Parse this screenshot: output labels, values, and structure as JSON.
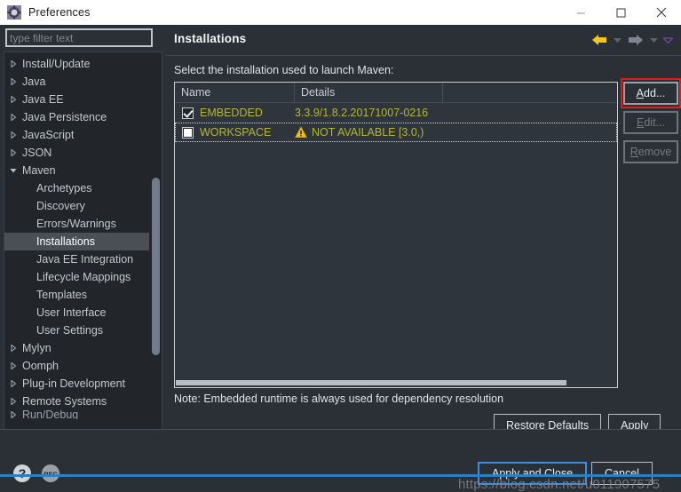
{
  "window": {
    "title": "Preferences",
    "icon": "preferences-gear-icon",
    "minimize_label": "minimize-icon",
    "maximize_label": "maximize-icon",
    "close_label": "close-icon"
  },
  "filter": {
    "placeholder": "type filter text",
    "value": ""
  },
  "sidebar": {
    "items": [
      {
        "label": "Install/Update",
        "level": 1,
        "expandable": true,
        "expanded": false,
        "selected": false
      },
      {
        "label": "Java",
        "level": 1,
        "expandable": true,
        "expanded": false,
        "selected": false
      },
      {
        "label": "Java EE",
        "level": 1,
        "expandable": true,
        "expanded": false,
        "selected": false
      },
      {
        "label": "Java Persistence",
        "level": 1,
        "expandable": true,
        "expanded": false,
        "selected": false
      },
      {
        "label": "JavaScript",
        "level": 1,
        "expandable": true,
        "expanded": false,
        "selected": false
      },
      {
        "label": "JSON",
        "level": 1,
        "expandable": true,
        "expanded": false,
        "selected": false
      },
      {
        "label": "Maven",
        "level": 1,
        "expandable": true,
        "expanded": true,
        "selected": false
      },
      {
        "label": "Archetypes",
        "level": 2,
        "expandable": false,
        "expanded": false,
        "selected": false
      },
      {
        "label": "Discovery",
        "level": 2,
        "expandable": false,
        "expanded": false,
        "selected": false
      },
      {
        "label": "Errors/Warnings",
        "level": 2,
        "expandable": false,
        "expanded": false,
        "selected": false
      },
      {
        "label": "Installations",
        "level": 2,
        "expandable": false,
        "expanded": false,
        "selected": true
      },
      {
        "label": "Java EE Integration",
        "level": 2,
        "expandable": false,
        "expanded": false,
        "selected": false
      },
      {
        "label": "Lifecycle Mappings",
        "level": 2,
        "expandable": false,
        "expanded": false,
        "selected": false
      },
      {
        "label": "Templates",
        "level": 2,
        "expandable": false,
        "expanded": false,
        "selected": false
      },
      {
        "label": "User Interface",
        "level": 2,
        "expandable": false,
        "expanded": false,
        "selected": false
      },
      {
        "label": "User Settings",
        "level": 2,
        "expandable": false,
        "expanded": false,
        "selected": false
      },
      {
        "label": "Mylyn",
        "level": 1,
        "expandable": true,
        "expanded": false,
        "selected": false
      },
      {
        "label": "Oomph",
        "level": 1,
        "expandable": true,
        "expanded": false,
        "selected": false
      },
      {
        "label": "Plug-in Development",
        "level": 1,
        "expandable": true,
        "expanded": false,
        "selected": false
      },
      {
        "label": "Remote Systems",
        "level": 1,
        "expandable": true,
        "expanded": false,
        "selected": false
      },
      {
        "label": "Run/Debug",
        "level": 1,
        "expandable": true,
        "expanded": false,
        "selected": false
      }
    ]
  },
  "pane": {
    "title": "Installations",
    "prompt": "Select the installation used to launch Maven:",
    "note": "Note: Embedded runtime is always used for dependency resolution",
    "nav": {
      "back_icon": "back-arrow-icon",
      "back_dropdown_icon": "chevron-down-icon",
      "forward_icon": "forward-arrow-icon",
      "forward_dropdown_icon": "chevron-down-icon",
      "menu_icon": "view-menu-chevron-icon"
    }
  },
  "table": {
    "columns": [
      "Name",
      "Details",
      ""
    ],
    "rows": [
      {
        "checked": true,
        "name": "EMBEDDED",
        "details": "3.3.9/1.8.2.20171007-0216",
        "warning": false,
        "focused": false
      },
      {
        "checked": false,
        "name": "WORKSPACE",
        "details": "NOT AVAILABLE [3.0,)",
        "warning": true,
        "warning_icon": "warning-triangle-icon",
        "focused": true
      }
    ]
  },
  "side_buttons": [
    {
      "label": "Add...",
      "mnemonic": "A",
      "enabled": true,
      "highlighted": true
    },
    {
      "label": "Edit...",
      "mnemonic": "E",
      "enabled": false,
      "highlighted": false
    },
    {
      "label": "Remove",
      "mnemonic": "R",
      "enabled": false,
      "highlighted": false
    }
  ],
  "pane_buttons": [
    {
      "label": "Restore Defaults",
      "mnemonic": "D"
    },
    {
      "label": "Apply",
      "mnemonic": "A"
    }
  ],
  "footer": {
    "help_icon": "help-question-icon",
    "rec_icon": "rec-recorder-icon",
    "buttons": [
      {
        "label": "Apply and Close",
        "primary": true
      },
      {
        "label": "Cancel",
        "primary": false
      }
    ],
    "watermark": "https://blog.csdn.net/u011907575"
  },
  "colors": {
    "accent_yellow": "#b5b53a",
    "highlight_red": "#e41b1b",
    "focus_blue": "#3a8ee6",
    "selection": "#4a4f56",
    "background": "#2b3036"
  }
}
